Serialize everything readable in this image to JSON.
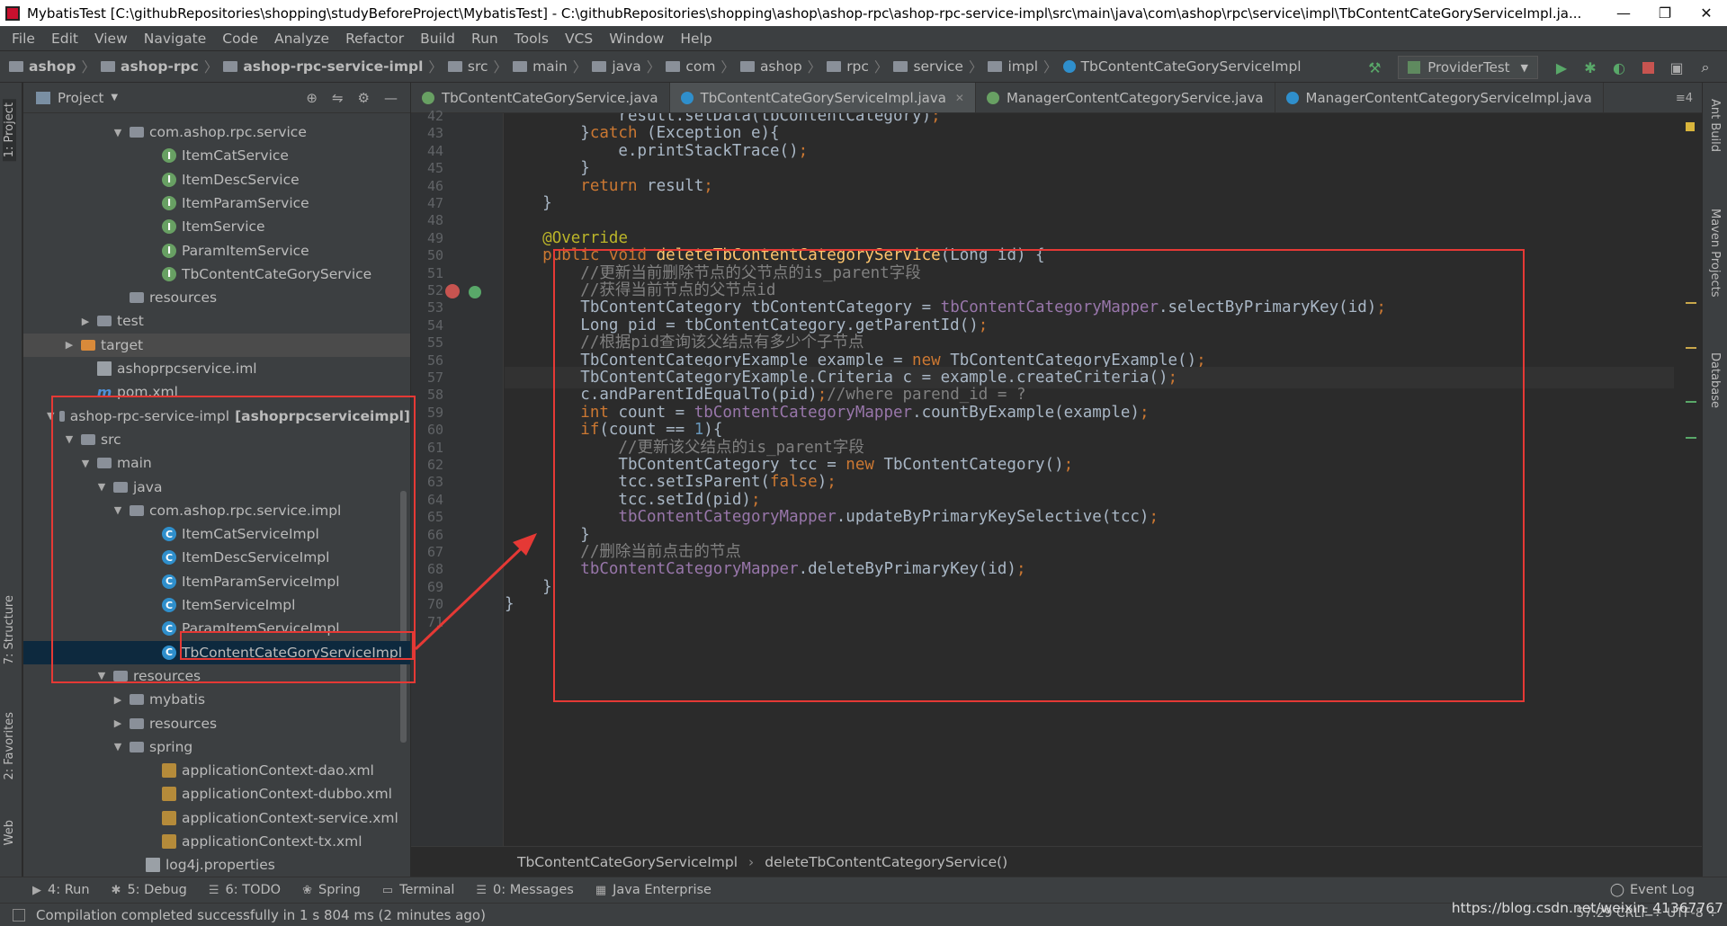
{
  "window": {
    "title": "MybatisTest [C:\\githubRepositories\\shopping\\studyBeforeProject\\MybatisTest] - C:\\githubRepositories\\shopping\\ashop\\ashop-rpc\\ashop-rpc-service-impl\\src\\main\\java\\com\\ashop\\rpc\\service\\impl\\TbContentCateGoryServiceImpl.ja...",
    "minimize": "—",
    "restore": "❐",
    "close": "✕"
  },
  "menu": [
    "File",
    "Edit",
    "View",
    "Navigate",
    "Code",
    "Analyze",
    "Refactor",
    "Build",
    "Run",
    "Tools",
    "VCS",
    "Window",
    "Help"
  ],
  "nav": {
    "crumbs": [
      "ashop",
      "ashop-rpc",
      "ashop-rpc-service-impl",
      "src",
      "main",
      "java",
      "com",
      "ashop",
      "rpc",
      "service",
      "impl",
      "TbContentCateGoryServiceImpl"
    ],
    "run_config": "ProviderTest"
  },
  "left_strip": {
    "project": "1: Project",
    "structure": "7: Structure",
    "favorites": "2: Favorites",
    "web": "Web"
  },
  "right_strip": {
    "ant": "Ant Build",
    "maven": "Maven Projects",
    "database": "Database"
  },
  "project": {
    "title": "Project",
    "tree": [
      {
        "label": "com.ashop.rpc.service",
        "icon": "package",
        "indent": 5,
        "arrow": "▼"
      },
      {
        "label": "ItemCatService",
        "icon": "interface",
        "indent": 7,
        "arrow": ""
      },
      {
        "label": "ItemDescService",
        "icon": "interface",
        "indent": 7,
        "arrow": ""
      },
      {
        "label": "ItemParamService",
        "icon": "interface",
        "indent": 7,
        "arrow": ""
      },
      {
        "label": "ItemService",
        "icon": "interface",
        "indent": 7,
        "arrow": ""
      },
      {
        "label": "ParamItemService",
        "icon": "interface",
        "indent": 7,
        "arrow": ""
      },
      {
        "label": "TbContentCateGoryService",
        "icon": "interface",
        "indent": 7,
        "arrow": ""
      },
      {
        "label": "resources",
        "icon": "folder",
        "indent": 5,
        "arrow": ""
      },
      {
        "label": "test",
        "icon": "folder",
        "indent": 3,
        "arrow": "▶"
      },
      {
        "label": "target",
        "icon": "ofolder",
        "indent": 2,
        "arrow": "▶",
        "hl": true
      },
      {
        "label": "ashoprpcservice.iml",
        "icon": "file",
        "indent": 3,
        "arrow": ""
      },
      {
        "label": "pom.xml",
        "icon": "maven",
        "indent": 3,
        "arrow": ""
      },
      {
        "label": "ashop-rpc-service-impl",
        "bold_suffix": "[ashoprpcserviceimpl]",
        "icon": "folder",
        "indent": 1,
        "arrow": "▼"
      },
      {
        "label": "src",
        "icon": "folder",
        "indent": 2,
        "arrow": "▼"
      },
      {
        "label": "main",
        "icon": "folder",
        "indent": 3,
        "arrow": "▼"
      },
      {
        "label": "java",
        "icon": "folder",
        "indent": 4,
        "arrow": "▼"
      },
      {
        "label": "com.ashop.rpc.service.impl",
        "icon": "package",
        "indent": 5,
        "arrow": "▼"
      },
      {
        "label": "ItemCatServiceImpl",
        "icon": "class",
        "indent": 7,
        "arrow": ""
      },
      {
        "label": "ItemDescServiceImpl",
        "icon": "class",
        "indent": 7,
        "arrow": ""
      },
      {
        "label": "ItemParamServiceImpl",
        "icon": "class",
        "indent": 7,
        "arrow": ""
      },
      {
        "label": "ItemServiceImpl",
        "icon": "class",
        "indent": 7,
        "arrow": ""
      },
      {
        "label": "ParamItemServiceImpl",
        "icon": "class",
        "indent": 7,
        "arrow": ""
      },
      {
        "label": "TbContentCateGoryServiceImpl",
        "icon": "class",
        "indent": 7,
        "arrow": "",
        "selected": true
      },
      {
        "label": "resources",
        "icon": "folder",
        "indent": 4,
        "arrow": "▼"
      },
      {
        "label": "mybatis",
        "icon": "folder",
        "indent": 5,
        "arrow": "▶"
      },
      {
        "label": "resources",
        "icon": "folder",
        "indent": 5,
        "arrow": "▶"
      },
      {
        "label": "spring",
        "icon": "folder",
        "indent": 5,
        "arrow": "▼"
      },
      {
        "label": "applicationContext-dao.xml",
        "icon": "xml",
        "indent": 7,
        "arrow": ""
      },
      {
        "label": "applicationContext-dubbo.xml",
        "icon": "xml",
        "indent": 7,
        "arrow": ""
      },
      {
        "label": "applicationContext-service.xml",
        "icon": "xml",
        "indent": 7,
        "arrow": ""
      },
      {
        "label": "applicationContext-tx.xml",
        "icon": "xml",
        "indent": 7,
        "arrow": ""
      },
      {
        "label": "log4j.properties",
        "icon": "file",
        "indent": 6,
        "arrow": ""
      }
    ]
  },
  "tabs": [
    {
      "label": "TbContentCateGoryService.java",
      "icon_color": "#68a063",
      "active": false
    },
    {
      "label": "TbContentCateGoryServiceImpl.java",
      "icon_color": "#2f8fcc",
      "active": true
    },
    {
      "label": "ManagerContentCategoryService.java",
      "icon_color": "#68a063",
      "active": false
    },
    {
      "label": "ManagerContentCategoryServiceImpl.java",
      "icon_color": "#2f8fcc",
      "active": false
    }
  ],
  "tabs_overflow": "≡4",
  "code": {
    "line_numbers": [
      "42",
      "43",
      "44",
      "45",
      "46",
      "47",
      "48",
      "49",
      "50",
      "51",
      "52",
      "53",
      "54",
      "55",
      "56",
      "57",
      "58",
      "59",
      "60",
      "61",
      "62",
      "63",
      "64",
      "65",
      "66",
      "67",
      "68",
      "69",
      "70",
      "71"
    ],
    "lines": [
      "            result.setData(tbContentCategory);",
      "        }catch (Exception e){",
      "            e.printStackTrace();",
      "        }",
      "        return result;",
      "    }",
      "",
      "    @Override",
      "    public void deleteTbContentCategoryService(Long id) {",
      "        //更新当前删除节点的父节点的is_parent字段",
      "        //获得当前节点的父节点id",
      "        TbContentCategory tbContentCategory = tbContentCategoryMapper.selectByPrimaryKey(id);",
      "        Long pid = tbContentCategory.getParentId();",
      "        //根据pid查询该父结点有多少个子节点",
      "        TbContentCategoryExample example = new TbContentCategoryExample();",
      "        TbContentCategoryExample.Criteria c = example.createCriteria();",
      "        c.andParentIdEqualTo(pid);//where parend_id = ?",
      "        int count = tbContentCategoryMapper.countByExample(example);",
      "        if(count == 1){",
      "            //更新该父结点的is_parent字段",
      "            TbContentCategory tcc = new TbContentCategory();",
      "            tcc.setIsParent(false);",
      "            tcc.setId(pid);",
      "            tbContentCategoryMapper.updateByPrimaryKeySelective(tcc);",
      "        }",
      "        //删除当前点击的节点",
      "        tbContentCategoryMapper.deleteByPrimaryKey(id);",
      "    }",
      "}",
      ""
    ]
  },
  "breadcrumb": {
    "class_name": "TbContentCateGoryServiceImpl",
    "sep": "›",
    "method": "deleteTbContentCategoryService()"
  },
  "bottom_tools": [
    {
      "icon": "▶",
      "label": "4: Run"
    },
    {
      "icon": "✱",
      "label": "5: Debug"
    },
    {
      "icon": "☰",
      "label": "6: TODO"
    },
    {
      "icon": "❀",
      "label": "Spring"
    },
    {
      "icon": "▭",
      "label": "Terminal"
    },
    {
      "icon": "☰",
      "label": "0: Messages"
    },
    {
      "icon": "▦",
      "label": "Java Enterprise"
    }
  ],
  "event_log": "Event Log",
  "status": {
    "message": "Compilation completed successfully in 1 s 804 ms (2 minutes ago)",
    "position": "57:29  CRLF ÷  UTF-8 ÷",
    "watermark": "https://blog.csdn.net/weixin_41367767"
  }
}
